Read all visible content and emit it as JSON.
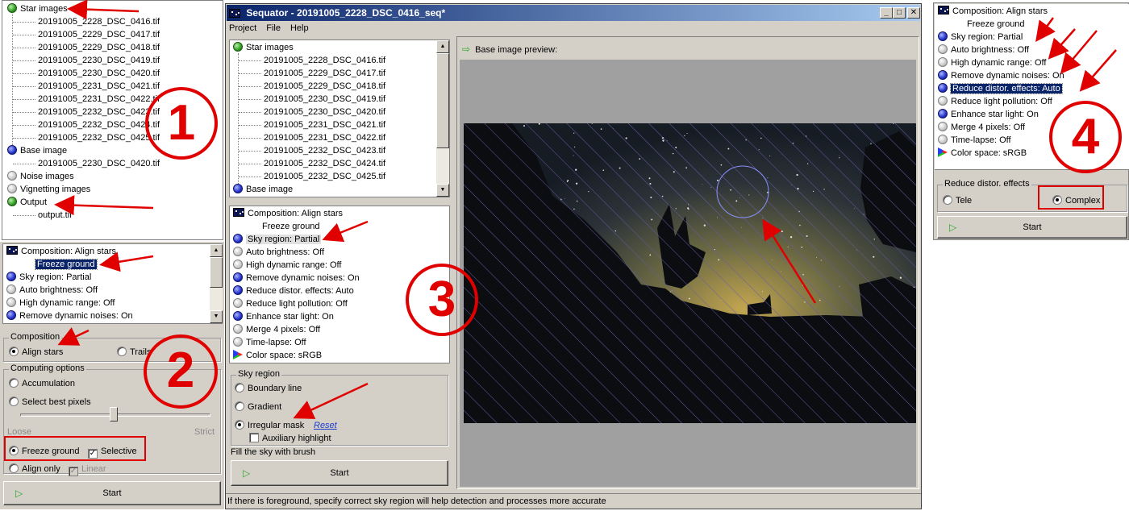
{
  "files": [
    "20191005_2228_DSC_0416.tif",
    "20191005_2229_DSC_0417.tif",
    "20191005_2229_DSC_0418.tif",
    "20191005_2230_DSC_0419.tif",
    "20191005_2230_DSC_0420.tif",
    "20191005_2231_DSC_0421.tif",
    "20191005_2231_DSC_0422.tif",
    "20191005_2232_DSC_0423.tif",
    "20191005_2232_DSC_0424.tif",
    "20191005_2232_DSC_0425.tif"
  ],
  "panel1": {
    "star_images": "Star images",
    "base_image": "Base image",
    "base_file": "20191005_2230_DSC_0420.tif",
    "noise_images": "Noise images",
    "vignetting_images": "Vignetting images",
    "output": "Output",
    "output_file": "output.tif"
  },
  "panel2": {
    "settings": [
      "Composition: Align stars",
      "Freeze ground",
      "Sky region: Partial",
      "Auto brightness: Off",
      "High dynamic range: Off",
      "Remove dynamic noises: On"
    ],
    "composition_label": "Composition",
    "align_stars": "Align stars",
    "trails": "Trails",
    "computing_label": "Computing options",
    "accumulation": "Accumulation",
    "select_best": "Select best pixels",
    "loose": "Loose",
    "strict": "Strict",
    "freeze_ground": "Freeze ground",
    "selective": "Selective",
    "align_only": "Align only",
    "linear": "Linear",
    "start": "Start"
  },
  "window": {
    "title": "Sequator - 20191005_2228_DSC_0416_seq*",
    "menu": [
      "Project",
      "File",
      "Help"
    ],
    "preview_label": "Base image preview:",
    "status": "If there is foreground, specify correct sky region will help detection and processes more accurate"
  },
  "panel3": {
    "star_images": "Star images",
    "base_image": "Base image",
    "settings": [
      "Composition: Align stars",
      "Freeze ground",
      "Sky region: Partial",
      "Auto brightness: Off",
      "High dynamic range: Off",
      "Remove dynamic noises: On",
      "Reduce distor. effects: Auto",
      "Reduce light pollution: Off",
      "Enhance star light: On",
      "Merge 4 pixels: Off",
      "Time-lapse: Off",
      "Color space: sRGB"
    ],
    "sky_region_label": "Sky region",
    "boundary_line": "Boundary line",
    "gradient": "Gradient",
    "irregular_mask": "Irregular mask",
    "reset": "Reset",
    "aux_highlight": "Auxiliary highlight",
    "fill_sky": "Fill the sky with brush",
    "start": "Start"
  },
  "panel4": {
    "settings": [
      "Composition: Align stars",
      "Freeze ground",
      "Sky region: Partial",
      "Auto brightness: Off",
      "High dynamic range: Off",
      "Remove dynamic noises: On",
      "Reduce distor. effects: Auto",
      "Reduce light pollution: Off",
      "Enhance star light: On",
      "Merge 4 pixels: Off",
      "Time-lapse: Off",
      "Color space: sRGB"
    ],
    "group_label": "Reduce distor. effects",
    "tele": "Tele",
    "complex": "Complex",
    "start": "Start"
  },
  "annotations": [
    "1",
    "2",
    "3",
    "4"
  ],
  "colors": {
    "annotation_red": "#e00000",
    "title_blue": "#0a246a",
    "control_gray": "#d4d0c8"
  }
}
